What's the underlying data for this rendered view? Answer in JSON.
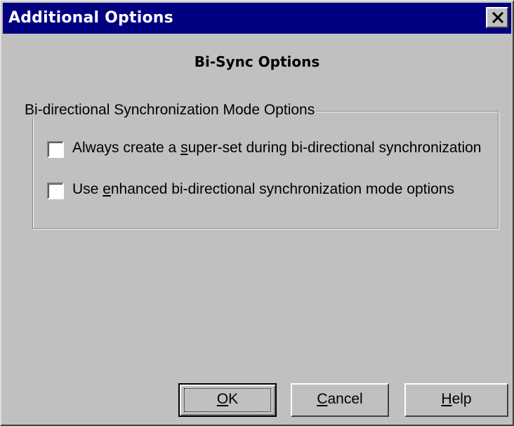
{
  "window": {
    "title": "Additional Options",
    "close_icon": "close-icon"
  },
  "heading": "Bi-Sync Options",
  "group": {
    "legend": "Bi-directional Synchronization Mode Options",
    "options": [
      {
        "pre": "Always create a ",
        "mnemonic": "s",
        "post": "uper-set during bi-directional synchronization",
        "checked": false
      },
      {
        "pre": "Use ",
        "mnemonic": "e",
        "post": "nhanced bi-directional synchronization mode options",
        "checked": false
      }
    ]
  },
  "buttons": {
    "ok": {
      "mnemonic": "O",
      "rest": "K"
    },
    "cancel": {
      "mnemonic": "C",
      "rest": "ancel"
    },
    "help": {
      "mnemonic": "H",
      "rest": "elp"
    }
  },
  "colors": {
    "titlebar": "#000080",
    "face": "#c0c0c0"
  }
}
